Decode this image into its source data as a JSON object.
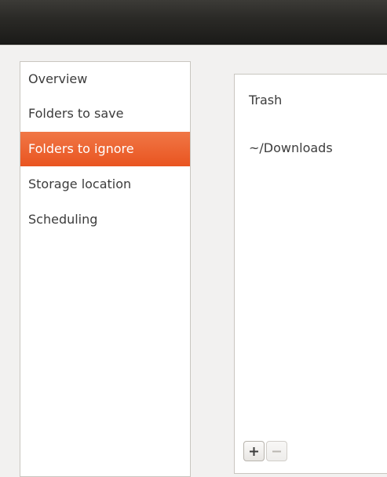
{
  "sidebar": {
    "items": [
      {
        "label": "Overview"
      },
      {
        "label": "Folders to save"
      },
      {
        "label": "Folders to ignore",
        "selected": true
      },
      {
        "label": "Storage location"
      },
      {
        "label": "Scheduling"
      }
    ]
  },
  "ignore_list": {
    "items": [
      {
        "label": "Trash"
      },
      {
        "label": "~/Downloads"
      }
    ]
  },
  "toolbar": {
    "add_icon": "plus-icon",
    "remove_icon": "minus-icon",
    "remove_disabled": true
  },
  "colors": {
    "selection": "#e95420",
    "titlebar": "#2b2a27",
    "window_bg": "#f2f1f0"
  }
}
